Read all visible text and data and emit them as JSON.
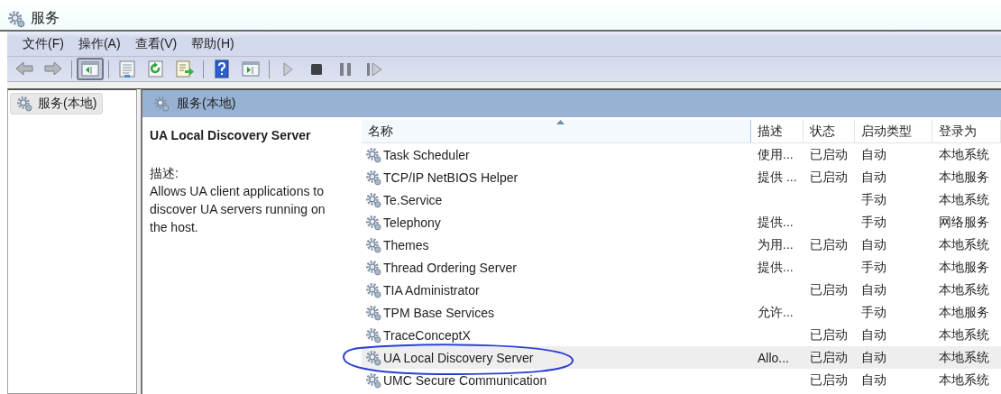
{
  "window": {
    "title": "服务"
  },
  "menu": [
    {
      "label": "文件(F)"
    },
    {
      "label": "操作(A)"
    },
    {
      "label": "查看(V)"
    },
    {
      "label": "帮助(H)"
    }
  ],
  "toolbar": [
    {
      "kind": "back",
      "pressed": false
    },
    {
      "kind": "forward",
      "pressed": false
    },
    {
      "kind": "separator"
    },
    {
      "kind": "tree",
      "pressed": true
    },
    {
      "kind": "separator"
    },
    {
      "kind": "properties",
      "pressed": false
    },
    {
      "kind": "refresh",
      "pressed": false
    },
    {
      "kind": "export",
      "pressed": false
    },
    {
      "kind": "separator"
    },
    {
      "kind": "help",
      "pressed": false
    },
    {
      "kind": "actionpane",
      "pressed": false
    },
    {
      "kind": "separator"
    },
    {
      "kind": "play",
      "pressed": false
    },
    {
      "kind": "stop",
      "pressed": false
    },
    {
      "kind": "pause",
      "pressed": false
    },
    {
      "kind": "resume",
      "pressed": false
    }
  ],
  "tree": {
    "items": [
      {
        "label": "服务(本地)",
        "selected": true
      }
    ]
  },
  "panel": {
    "title": "服务(本地)"
  },
  "detail": {
    "name": "UA Local Discovery Server",
    "description_label": "描述:",
    "description": "Allows UA client applications to discover UA servers running on the host."
  },
  "table": {
    "columns": [
      {
        "label": "名称",
        "sorted": true
      },
      {
        "label": "描述",
        "sorted": false
      },
      {
        "label": "状态",
        "sorted": false
      },
      {
        "label": "启动类型",
        "sorted": false
      },
      {
        "label": "登录为",
        "sorted": false
      }
    ],
    "rows": [
      {
        "name": "Task Scheduler",
        "description": "使用...",
        "status": "已启动",
        "startup": "自动",
        "logon": "本地系统",
        "selected": false,
        "circled": false
      },
      {
        "name": "TCP/IP NetBIOS Helper",
        "description": "提供 ...",
        "status": "已启动",
        "startup": "自动",
        "logon": "本地服务",
        "selected": false,
        "circled": false
      },
      {
        "name": "Te.Service",
        "startup": "手动",
        "logon": "本地系统",
        "selected": false,
        "circled": false
      },
      {
        "name": "Telephony",
        "description": "提供...",
        "startup": "手动",
        "logon": "网络服务",
        "selected": false,
        "circled": false
      },
      {
        "name": "Themes",
        "description": "为用...",
        "status": "已启动",
        "startup": "自动",
        "logon": "本地系统",
        "selected": false,
        "circled": false
      },
      {
        "name": "Thread Ordering Server",
        "description": "提供...",
        "startup": "手动",
        "logon": "本地服务",
        "selected": false,
        "circled": false
      },
      {
        "name": "TIA Administrator",
        "status": "已启动",
        "startup": "自动",
        "logon": "本地系统",
        "selected": false,
        "circled": false
      },
      {
        "name": "TPM Base Services",
        "description": "允许...",
        "startup": "手动",
        "logon": "本地服务",
        "selected": false,
        "circled": false
      },
      {
        "name": "TraceConceptX",
        "status": "已启动",
        "startup": "自动",
        "logon": "本地系统",
        "selected": false,
        "circled": false
      },
      {
        "name": "UA Local Discovery Server",
        "description": "Allo...",
        "status": "已启动",
        "startup": "自动",
        "logon": "本地系统",
        "selected": true,
        "circled": true
      },
      {
        "name": "UMC Secure Communication",
        "status": "已启动",
        "startup": "自动",
        "logon": "本地系统",
        "selected": false,
        "circled": false
      }
    ]
  }
}
